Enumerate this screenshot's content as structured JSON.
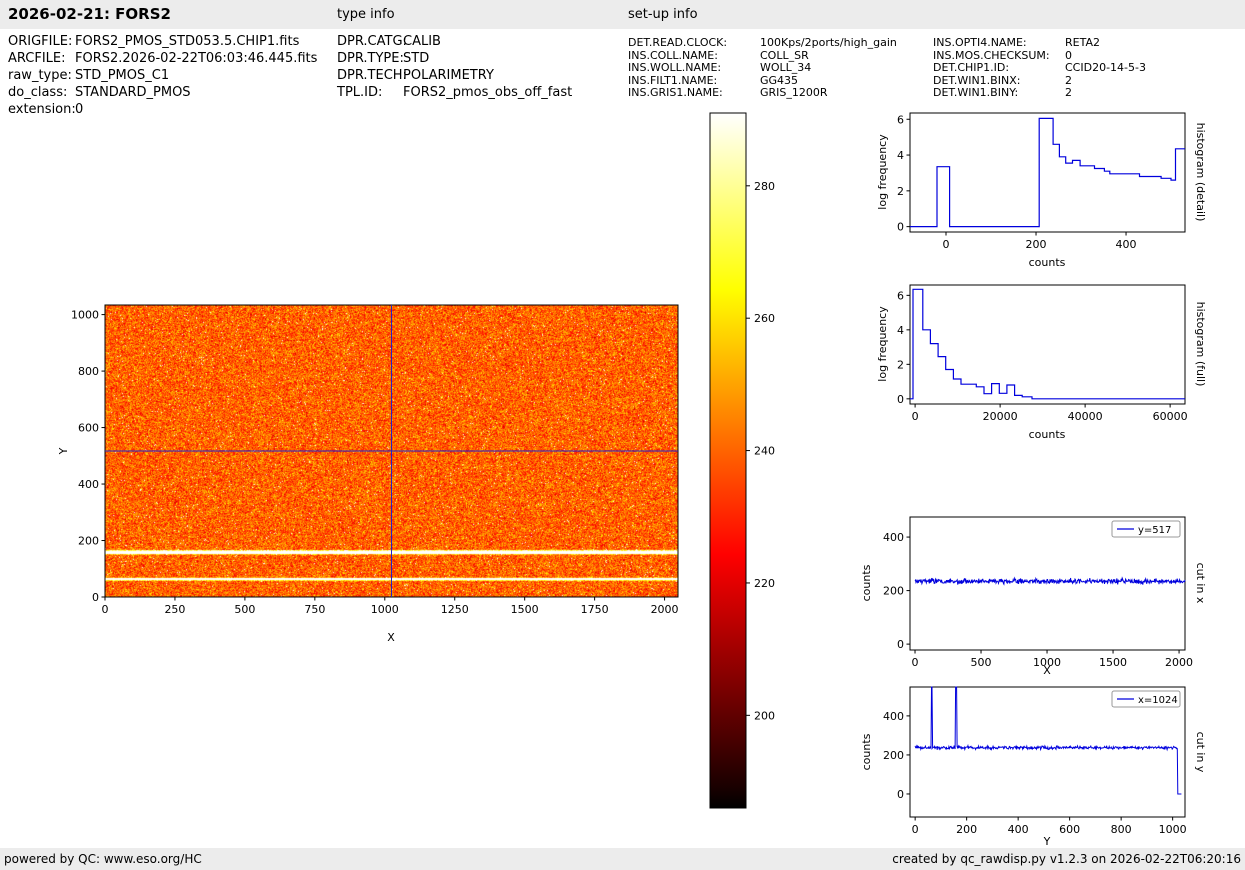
{
  "header": {
    "title": "2026-02-21: FORS2",
    "type_info": "type info",
    "setup_info": "set-up info"
  },
  "metadata": {
    "file_info": [
      {
        "label": "ORIGFILE:",
        "value": "FORS2_PMOS_STD053.5.CHIP1.fits"
      },
      {
        "label": "ARCFILE:",
        "value": "FORS2.2026-02-22T06:03:46.445.fits"
      },
      {
        "label": "raw_type:",
        "value": "STD_PMOS_C1"
      },
      {
        "label": "do_class:",
        "value": "STANDARD_PMOS"
      },
      {
        "label": "extension:",
        "value": "0"
      }
    ],
    "type_info": [
      {
        "label": "DPR.CATG:",
        "value": "CALIB"
      },
      {
        "label": "DPR.TYPE:",
        "value": "STD"
      },
      {
        "label": "DPR.TECH:",
        "value": "POLARIMETRY"
      },
      {
        "label": "TPL.ID:",
        "value": "FORS2_pmos_obs_off_fast"
      }
    ],
    "setup_info_a": [
      {
        "label": "DET.READ.CLOCK:",
        "value": "100Kps/2ports/high_gain"
      },
      {
        "label": "INS.COLL.NAME:",
        "value": "COLL_SR"
      },
      {
        "label": "INS.WOLL.NAME:",
        "value": "WOLL_34"
      },
      {
        "label": "INS.FILT1.NAME:",
        "value": "GG435"
      },
      {
        "label": "INS.GRIS1.NAME:",
        "value": "GRIS_1200R"
      }
    ],
    "setup_info_b": [
      {
        "label": "INS.OPTI4.NAME:",
        "value": "RETA2"
      },
      {
        "label": "INS.MOS.CHECKSUM:",
        "value": "0"
      },
      {
        "label": "DET.CHIP1.ID:",
        "value": "CCID20-14-5-3"
      },
      {
        "label": "DET.WIN1.BINX:",
        "value": "2"
      },
      {
        "label": "DET.WIN1.BINY:",
        "value": "2"
      }
    ]
  },
  "footer": {
    "left": "powered by QC: www.eso.org/HC",
    "right": "created by qc_rawdisp.py v1.2.3 on 2026-02-22T06:20:16"
  },
  "colors": {
    "bar_bg": "#ececec",
    "line_blue": "#0000dd",
    "crosshair_blue": "#2323c8"
  },
  "chart_data": [
    {
      "id": "raw_image",
      "type": "heatmap",
      "xlabel": "X",
      "ylabel": "Y",
      "xlim": [
        0,
        2048
      ],
      "ylim": [
        0,
        1034
      ],
      "xticks": [
        0,
        250,
        500,
        750,
        1000,
        1250,
        1500,
        1750,
        2000
      ],
      "yticks": [
        0,
        200,
        400,
        600,
        800,
        1000
      ],
      "colormap": "hot",
      "background_counts_mean": 235,
      "noise_sigma": 10,
      "bright_lines_y": [
        {
          "y": 65,
          "counts": 560
        },
        {
          "y": 160,
          "counts": 545
        }
      ],
      "crosshair": {
        "x": 1024,
        "y": 517,
        "color": "#2323c8"
      },
      "colorbar": {
        "vmin": 186,
        "vmax": 291,
        "ticks": [
          200,
          220,
          240,
          260,
          280
        ]
      }
    },
    {
      "id": "histogram_detail",
      "type": "step",
      "right_label": "histogram (detail)",
      "xlabel": "counts",
      "ylabel": "log frequency",
      "xlim": [
        -80,
        531
      ],
      "ylim": [
        -0.3,
        6.35
      ],
      "xticks": [
        0,
        200,
        400
      ],
      "yticks": [
        0,
        2,
        4,
        6
      ],
      "line_color": "#0000dd",
      "steps": [
        [
          -80,
          0
        ],
        [
          -20,
          3.35
        ],
        [
          8,
          0
        ],
        [
          207,
          6.05
        ],
        [
          238,
          4.6
        ],
        [
          252,
          3.9
        ],
        [
          266,
          3.55
        ],
        [
          281,
          3.7
        ],
        [
          298,
          3.4
        ],
        [
          330,
          3.25
        ],
        [
          352,
          3.1
        ],
        [
          364,
          2.95
        ],
        [
          430,
          2.8
        ],
        [
          478,
          2.7
        ],
        [
          500,
          2.6
        ],
        [
          510,
          4.35
        ]
      ],
      "x_end": 531
    },
    {
      "id": "histogram_full",
      "type": "step",
      "right_label": "histogram (full)",
      "xlabel": "counts",
      "ylabel": "log frequency",
      "xlim": [
        -1200,
        63500
      ],
      "ylim": [
        -0.3,
        6.6
      ],
      "xticks": [
        0,
        20000,
        40000,
        60000
      ],
      "yticks": [
        0,
        2,
        4,
        6
      ],
      "line_color": "#0000dd",
      "steps": [
        [
          -1200,
          0
        ],
        [
          -500,
          6.35
        ],
        [
          1800,
          4.0
        ],
        [
          3600,
          3.2
        ],
        [
          5400,
          2.45
        ],
        [
          7200,
          1.7
        ],
        [
          9000,
          1.15
        ],
        [
          10800,
          0.85
        ],
        [
          14400,
          0.7
        ],
        [
          16200,
          0.3
        ],
        [
          18000,
          0.88
        ],
        [
          19800,
          0.32
        ],
        [
          21600,
          0.8
        ],
        [
          23400,
          0.2
        ],
        [
          25200,
          0.12
        ],
        [
          27500,
          0
        ]
      ],
      "x_end": 63500
    },
    {
      "id": "cut_in_x",
      "type": "line",
      "right_label": "cut in x",
      "xlabel": "X",
      "ylabel": "counts",
      "legend": "y=517",
      "xlim": [
        -38,
        2045
      ],
      "ylim": [
        -22,
        475
      ],
      "xticks": [
        0,
        500,
        1000,
        1500,
        2000
      ],
      "yticks": [
        0,
        200,
        400
      ],
      "line_color": "#0000dd",
      "series": {
        "x_start": 0,
        "x_end": 2045,
        "baseline": 235,
        "noise": 5,
        "points": 550
      }
    },
    {
      "id": "cut_in_y",
      "type": "line",
      "right_label": "cut in y",
      "xlabel": "Y",
      "ylabel": "counts",
      "legend": "x=1024",
      "xlim": [
        -20,
        1048
      ],
      "ylim": [
        -118,
        548
      ],
      "xticks": [
        0,
        200,
        400,
        600,
        800,
        1000
      ],
      "yticks": [
        0,
        200,
        400
      ],
      "line_color": "#0000dd",
      "series": {
        "x_start": 0,
        "x_end": 1034,
        "baseline": 237,
        "noise": 4,
        "points": 520,
        "spikes": [
          {
            "from": 62,
            "to": 67,
            "value": 560
          },
          {
            "from": 156,
            "to": 162,
            "value": 560
          }
        ],
        "zero_after": 1020
      }
    }
  ]
}
